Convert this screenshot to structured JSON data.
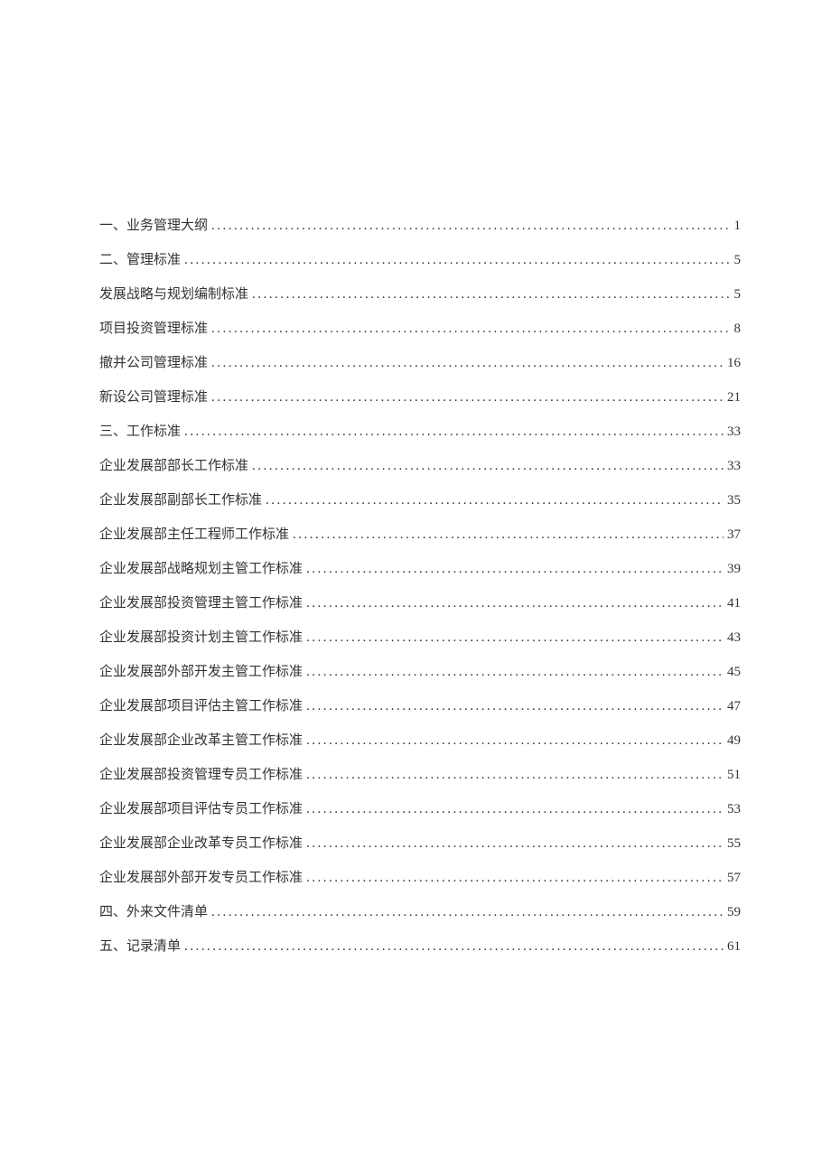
{
  "toc": {
    "entries": [
      {
        "title": "一、业务管理大纲",
        "page": "1"
      },
      {
        "title": "二、管理标准",
        "page": "5"
      },
      {
        "title": "发展战略与规划编制标准",
        "page": "5"
      },
      {
        "title": "项目投资管理标准",
        "page": "8"
      },
      {
        "title": "撤并公司管理标准",
        "page": "16"
      },
      {
        "title": "新设公司管理标准",
        "page": "21"
      },
      {
        "title": "三、工作标准",
        "page": "33"
      },
      {
        "title": "企业发展部部长工作标准",
        "page": "33"
      },
      {
        "title": "企业发展部副部长工作标准",
        "page": "35"
      },
      {
        "title": "企业发展部主任工程师工作标准",
        "page": "37"
      },
      {
        "title": "企业发展部战略规划主管工作标准",
        "page": "39"
      },
      {
        "title": "企业发展部投资管理主管工作标准",
        "page": "41"
      },
      {
        "title": "企业发展部投资计划主管工作标准",
        "page": "43"
      },
      {
        "title": "企业发展部外部开发主管工作标准",
        "page": "45"
      },
      {
        "title": "企业发展部项目评估主管工作标准",
        "page": "47"
      },
      {
        "title": "企业发展部企业改革主管工作标准",
        "page": "49"
      },
      {
        "title": "企业发展部投资管理专员工作标准",
        "page": "51"
      },
      {
        "title": "企业发展部项目评估专员工作标准",
        "page": "53"
      },
      {
        "title": "企业发展部企业改革专员工作标准",
        "page": "55"
      },
      {
        "title": "企业发展部外部开发专员工作标准",
        "page": "57"
      },
      {
        "title": "四、外来文件清单",
        "page": "59"
      },
      {
        "title": "五、记录清单",
        "page": "61"
      }
    ]
  }
}
